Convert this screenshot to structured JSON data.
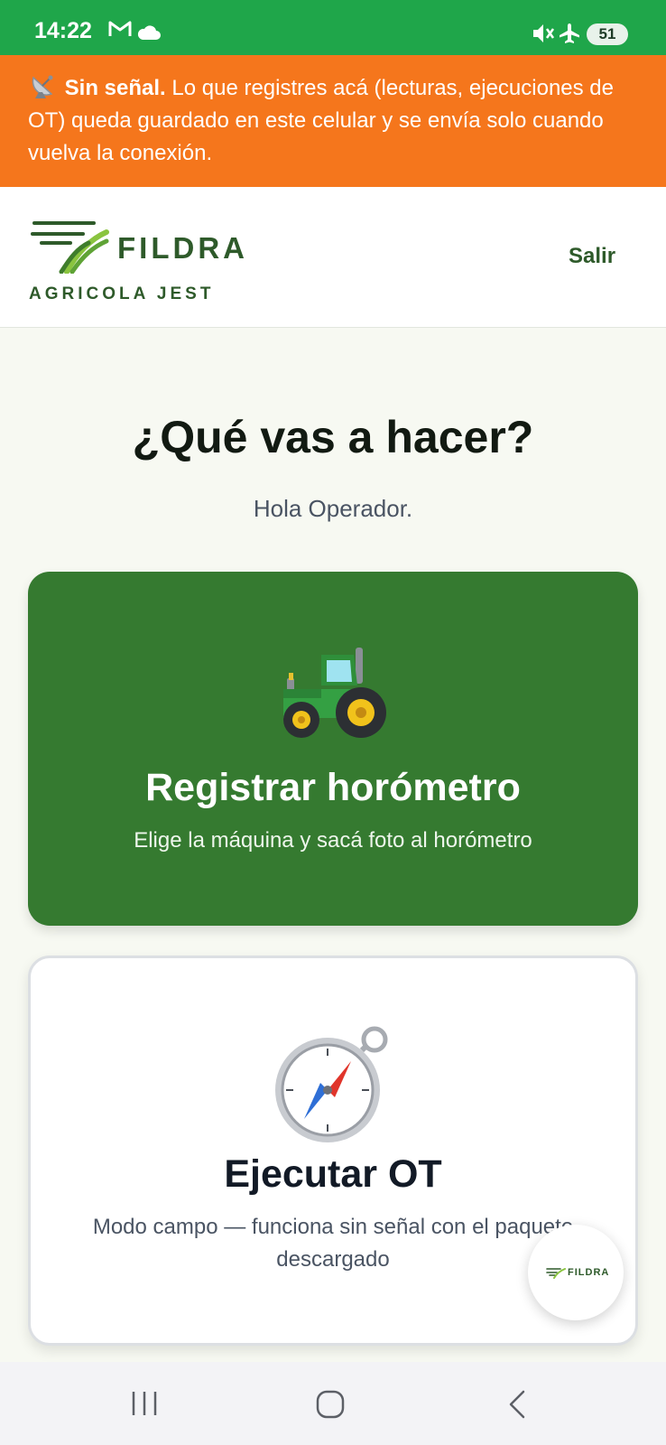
{
  "status_bar": {
    "time": "14:22",
    "battery": "51",
    "icons": [
      "gmail-icon",
      "cloud-icon",
      "mute-icon",
      "airplane-mode-icon",
      "battery-icon"
    ]
  },
  "offline_banner": {
    "icon": "satellite-antenna-icon",
    "strong": "Sin señal.",
    "text": "Lo que registres acá (lecturas, ejecuciones de OT) queda guardado en este celular y se envía solo cuando vuelva la conexión."
  },
  "header": {
    "brand_name": "FILDRA",
    "brand_sub": "AGRICOLA JEST",
    "logout_label": "Salir"
  },
  "main": {
    "title": "¿Qué vas a hacer?",
    "greeting": "Hola Operador."
  },
  "cards": [
    {
      "icon": "tractor-icon",
      "title": "Registrar horómetro",
      "description": "Elige la máquina y sacá foto al horómetro"
    },
    {
      "icon": "compass-icon",
      "title": "Ejecutar OT",
      "description": "Modo campo — funciona sin señal con el paquete descargado"
    }
  ],
  "fab": {
    "label": "FILDRA"
  },
  "colors": {
    "status_bar": "#1fa64a",
    "banner": "#f5761c",
    "brand": "#2e5a2a",
    "primary_card": "#357a30",
    "background": "#f7f9f2"
  }
}
